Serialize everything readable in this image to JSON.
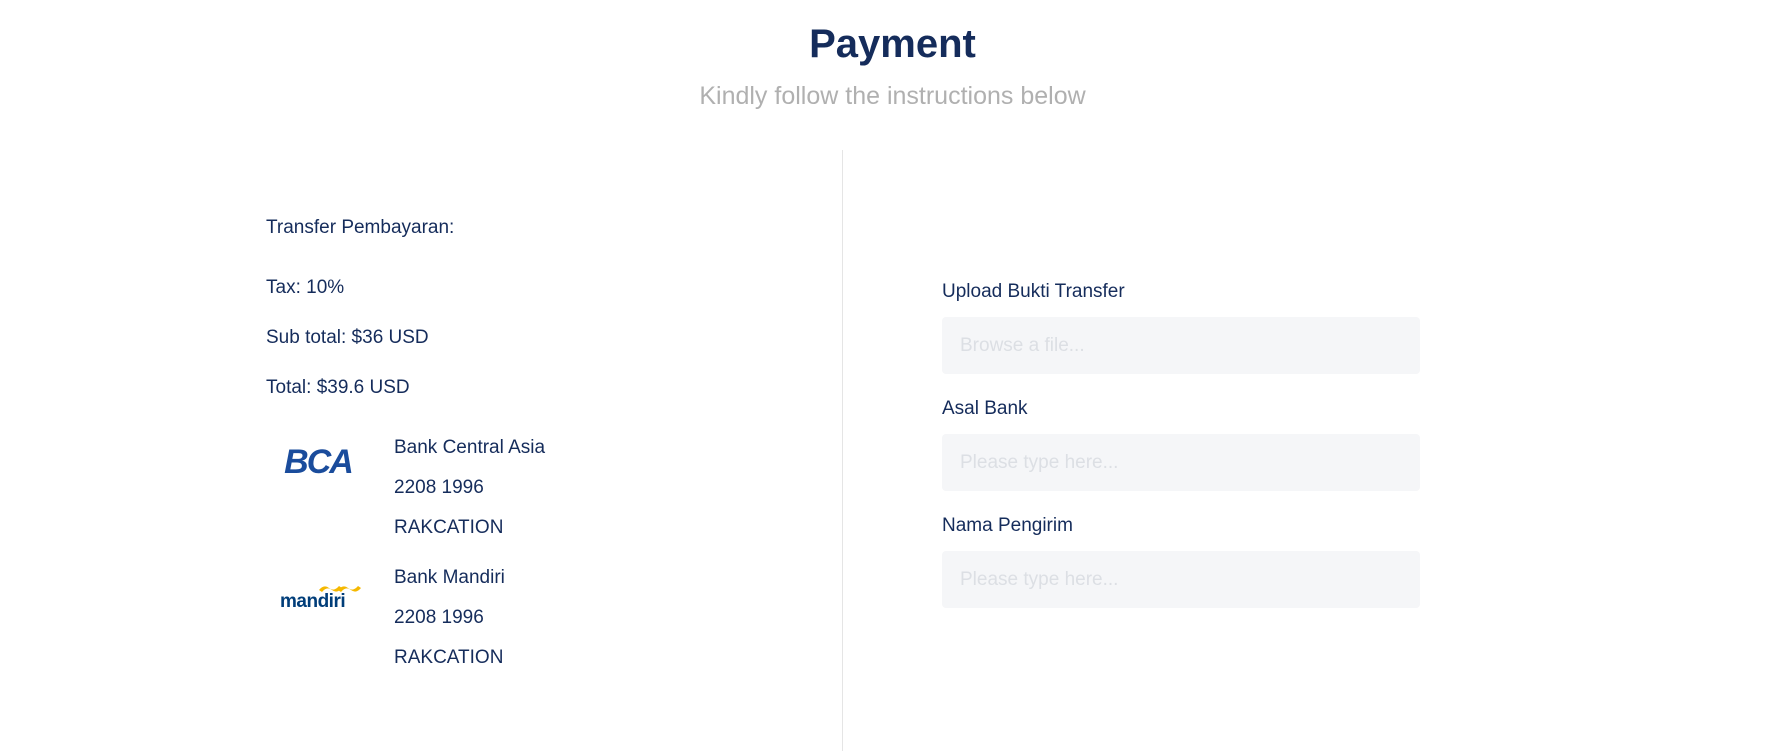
{
  "header": {
    "title": "Payment",
    "subtitle": "Kindly follow the instructions below"
  },
  "summary": {
    "heading": "Transfer Pembayaran:",
    "tax": "Tax: 10%",
    "subtotal": "Sub total: $36 USD",
    "total": "Total: $39.6 USD"
  },
  "banks": [
    {
      "logo_icon": "bca-logo",
      "logo_text": "BCA",
      "name": "Bank Central Asia",
      "account_number": "2208 1996",
      "account_name": "RAKCATION"
    },
    {
      "logo_icon": "mandiri-logo",
      "logo_text": "mandiri",
      "name": "Bank Mandiri",
      "account_number": "2208 1996",
      "account_name": "RAKCATION"
    }
  ],
  "form": {
    "upload_label": "Upload Bukti Transfer",
    "upload_placeholder": "Browse a file...",
    "bank_label": "Asal Bank",
    "bank_placeholder": "Please type here...",
    "sender_label": "Nama Pengirim",
    "sender_placeholder": "Please type here..."
  },
  "colors": {
    "primary_text": "#152c5b",
    "subtitle_text": "#b0b0b0",
    "input_bg": "#f5f6f8",
    "divider": "#e5e5e5",
    "bca_blue": "#1a4c9c",
    "mandiri_navy": "#003d79",
    "mandiri_gold": "#f5b800"
  }
}
